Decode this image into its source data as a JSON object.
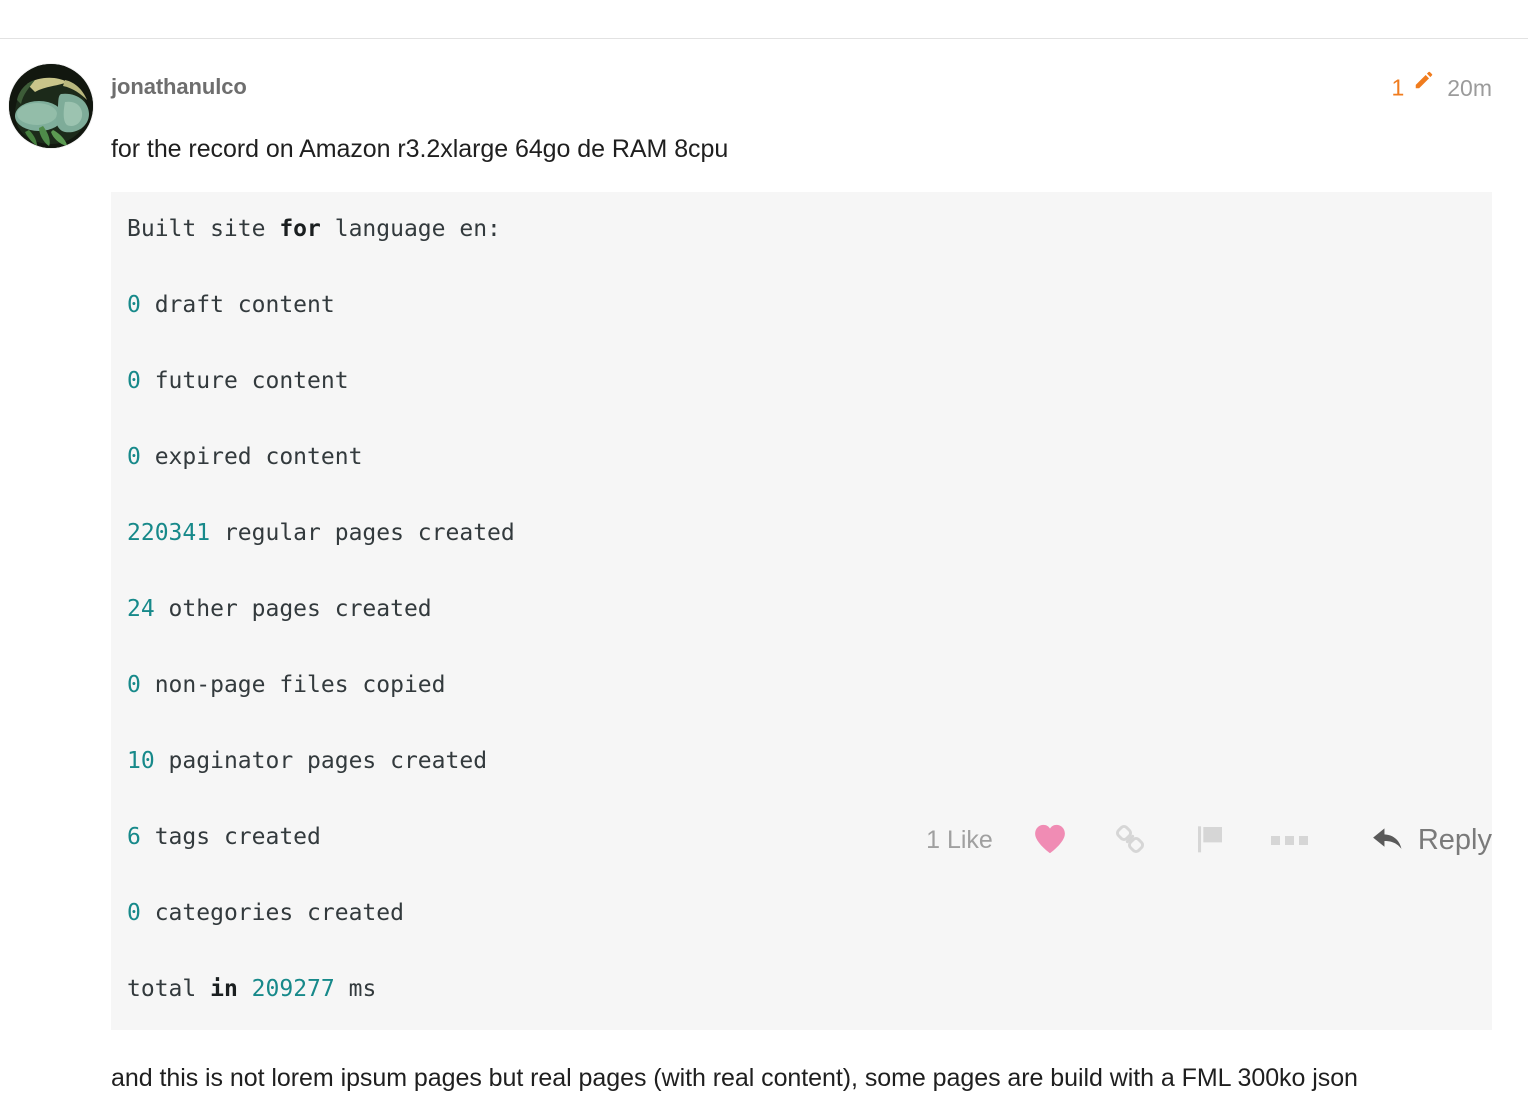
{
  "post": {
    "username": "jonathanulco",
    "edit_count": "1",
    "edit_icon": "pencil-icon",
    "time_ago": "20m",
    "paragraph_top": "for the record on Amazon r3.2xlarge 64go de RAM 8cpu",
    "paragraph_bottom": "and this is not lorem ipsum pages but real pages (with real content), some pages are build with a FML 300ko json",
    "code_lines": [
      [
        {
          "t": "Built site ",
          "c": "txt"
        },
        {
          "t": "for",
          "c": "kw"
        },
        {
          "t": " language en:",
          "c": "txt"
        }
      ],
      [
        {
          "t": "0",
          "c": "num"
        },
        {
          "t": " draft content",
          "c": "txt"
        }
      ],
      [
        {
          "t": "0",
          "c": "num"
        },
        {
          "t": " future content",
          "c": "txt"
        }
      ],
      [
        {
          "t": "0",
          "c": "num"
        },
        {
          "t": " expired content",
          "c": "txt"
        }
      ],
      [
        {
          "t": "220341",
          "c": "num"
        },
        {
          "t": " regular pages created",
          "c": "txt"
        }
      ],
      [
        {
          "t": "24",
          "c": "num"
        },
        {
          "t": " other pages created",
          "c": "txt"
        }
      ],
      [
        {
          "t": "0",
          "c": "num"
        },
        {
          "t": " non-page files copied",
          "c": "txt"
        }
      ],
      [
        {
          "t": "10",
          "c": "num"
        },
        {
          "t": " paginator pages created",
          "c": "txt"
        }
      ],
      [
        {
          "t": "6",
          "c": "num"
        },
        {
          "t": " tags created",
          "c": "txt"
        }
      ],
      [
        {
          "t": "0",
          "c": "num"
        },
        {
          "t": " categories created",
          "c": "txt"
        }
      ],
      [
        {
          "t": "total ",
          "c": "txt"
        },
        {
          "t": "in",
          "c": "kw"
        },
        {
          "t": " ",
          "c": "txt"
        },
        {
          "t": "209277",
          "c": "num"
        },
        {
          "t": " ms",
          "c": "txt"
        }
      ]
    ]
  },
  "footer": {
    "like_label": "1 Like",
    "like_icon": "heart-icon",
    "link_icon": "link-icon",
    "flag_icon": "flag-icon",
    "more_icon": "ellipsis-icon",
    "reply_icon": "reply-arrow-icon",
    "reply_label": "Reply"
  },
  "colors": {
    "edit_accent": "#f07c1e",
    "heart": "#f08cb4",
    "code_number": "#17898a",
    "code_bg": "#f6f6f6",
    "muted_text": "#9b9b9b",
    "icon_gray": "#d6d6d6",
    "body_text": "#1f1f1f"
  }
}
